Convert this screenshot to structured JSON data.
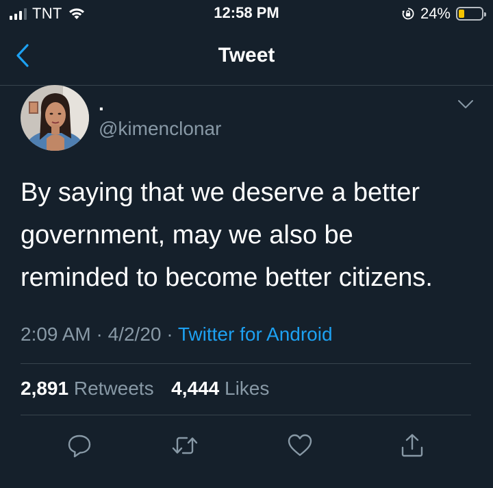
{
  "status_bar": {
    "carrier": "TNT",
    "time": "12:58 PM",
    "battery_percent": "24%",
    "battery_level": 0.24,
    "icons": [
      "signal-icon",
      "wifi-icon",
      "rotation-lock-icon",
      "battery-icon"
    ]
  },
  "nav": {
    "title": "Tweet",
    "back_icon": "chevron-left-icon"
  },
  "tweet": {
    "author_name": ".",
    "author_handle": "@kimenclonar",
    "text_lines": [
      "By saying that we deserve a better",
      "government, may we also be",
      "reminded to become better citizens."
    ],
    "time": "2:09 AM",
    "separator": "·",
    "date": "4/2/20",
    "source": "Twitter for Android",
    "retweets_count": "2,891",
    "retweets_label": "Retweets",
    "likes_count": "4,444",
    "likes_label": "Likes"
  },
  "actions": [
    {
      "name": "reply",
      "icon": "reply-icon"
    },
    {
      "name": "retweet",
      "icon": "retweet-icon"
    },
    {
      "name": "like",
      "icon": "heart-icon"
    },
    {
      "name": "share",
      "icon": "share-icon"
    }
  ],
  "colors": {
    "background": "#15202b",
    "text": "#ffffff",
    "secondary_text": "#8899a6",
    "accent": "#1da1f2",
    "divider": "#38444d",
    "battery": "#f5c400"
  }
}
